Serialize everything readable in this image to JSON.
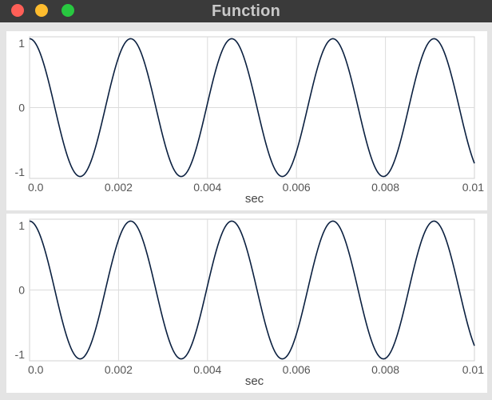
{
  "window": {
    "title": "Function"
  },
  "chart_data": [
    {
      "type": "line",
      "title": "",
      "xlabel": "sec",
      "ylabel": "",
      "xlim": [
        0,
        0.01
      ],
      "ylim": [
        -1.1,
        1.1
      ],
      "x_ticks": [
        "0.0",
        "0.002",
        "0.004",
        "0.006",
        "0.008",
        "0.01"
      ],
      "y_ticks": [
        "1",
        "0",
        "-1"
      ],
      "grid": true,
      "series": [
        {
          "function": "cos",
          "frequency_hz": 440,
          "amplitude": 1.07,
          "color": "#0b2040"
        }
      ]
    },
    {
      "type": "line",
      "title": "",
      "xlabel": "sec",
      "ylabel": "",
      "xlim": [
        0,
        0.01
      ],
      "ylim": [
        -1.1,
        1.1
      ],
      "x_ticks": [
        "0.0",
        "0.002",
        "0.004",
        "0.006",
        "0.008",
        "0.01"
      ],
      "y_ticks": [
        "1",
        "0",
        "-1"
      ],
      "grid": true,
      "series": [
        {
          "function": "cos",
          "frequency_hz": 440,
          "amplitude": 1.07,
          "color": "#0b2040"
        }
      ]
    }
  ]
}
